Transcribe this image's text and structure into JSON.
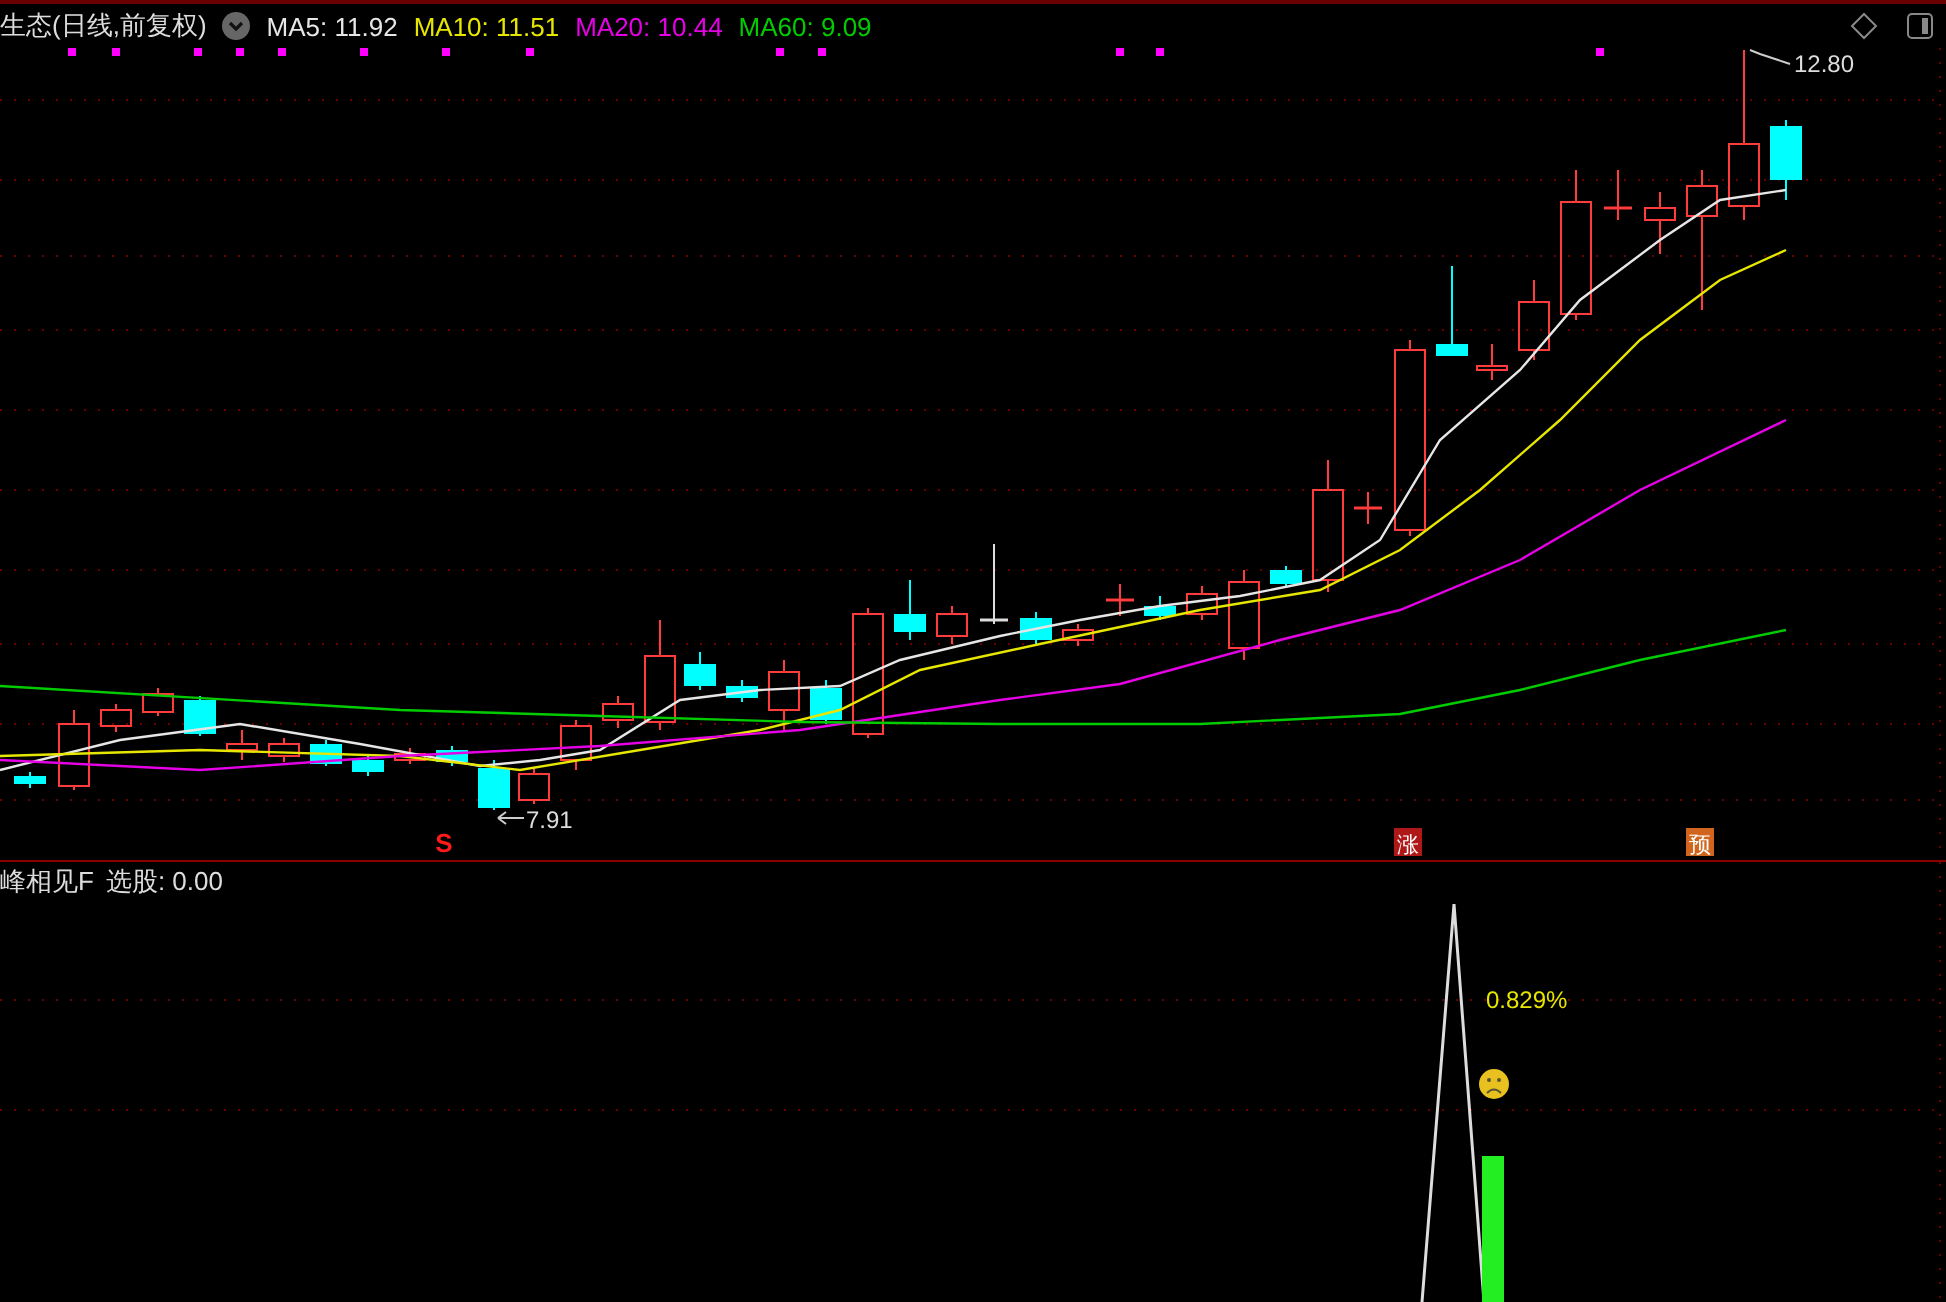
{
  "chart_header": {
    "title": "生态(日线,前复权)",
    "moving_averages": [
      {
        "label": "MA5: 11.92",
        "color": "#e6e6e6"
      },
      {
        "label": "MA10: 11.51",
        "color": "#e6e600"
      },
      {
        "label": "MA20: 10.44",
        "color": "#e600e6"
      },
      {
        "label": "MA60: 9.09",
        "color": "#00cc00"
      }
    ]
  },
  "price_labels": {
    "high": "12.80",
    "low": "7.91"
  },
  "signals": [
    {
      "label": "S",
      "color": "#ff1a1a"
    },
    {
      "label": "涨",
      "color": "#b01818"
    },
    {
      "label": "预",
      "color": "#d2651e"
    }
  ],
  "indicator_panel": {
    "name": "峰相见F",
    "reading": "选股: 0.00",
    "percent": "0.829%"
  }
}
